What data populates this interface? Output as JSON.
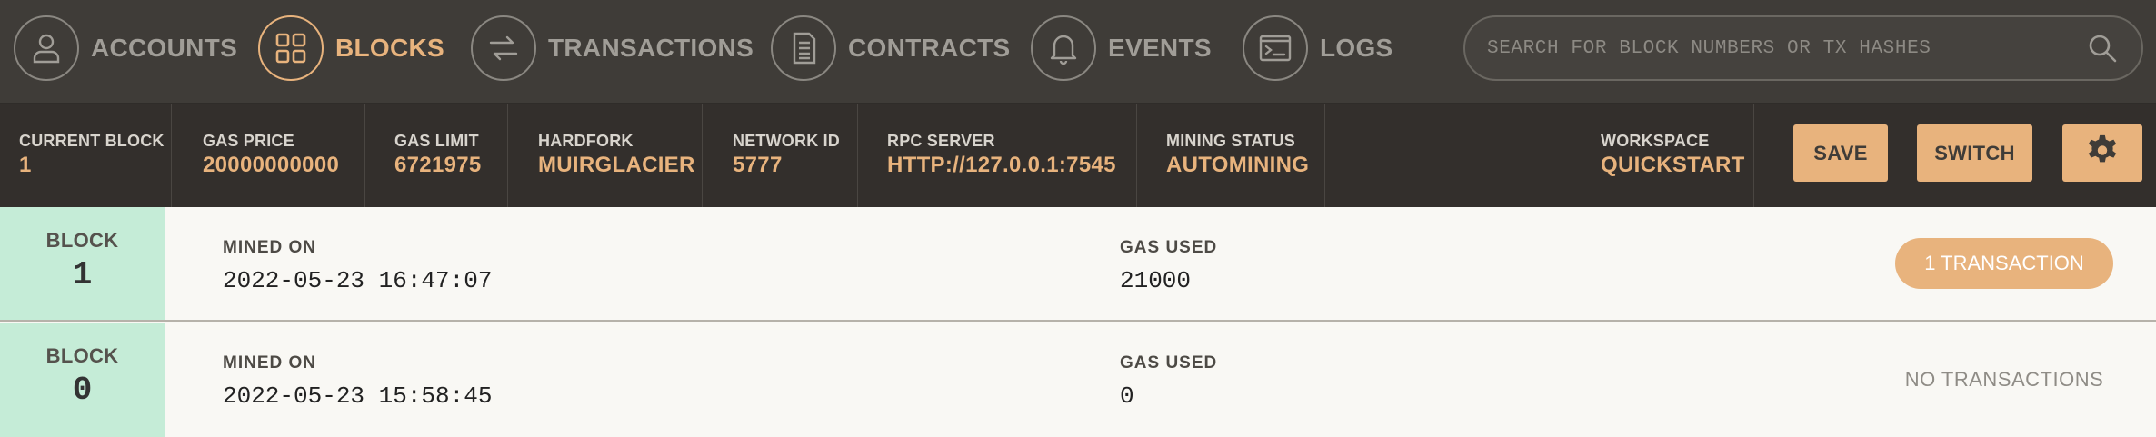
{
  "nav": {
    "items": [
      {
        "label": "ACCOUNTS",
        "icon": "user-icon",
        "active": false
      },
      {
        "label": "BLOCKS",
        "icon": "grid-icon",
        "active": true
      },
      {
        "label": "TRANSACTIONS",
        "icon": "swap-arrows-icon",
        "active": false
      },
      {
        "label": "CONTRACTS",
        "icon": "document-icon",
        "active": false
      },
      {
        "label": "EVENTS",
        "icon": "bell-icon",
        "active": false
      },
      {
        "label": "LOGS",
        "icon": "terminal-icon",
        "active": false
      }
    ],
    "search_placeholder": "SEARCH FOR BLOCK NUMBERS OR TX HASHES"
  },
  "status": {
    "current_block": {
      "label": "CURRENT BLOCK",
      "value": "1"
    },
    "gas_price": {
      "label": "GAS PRICE",
      "value": "20000000000"
    },
    "gas_limit": {
      "label": "GAS LIMIT",
      "value": "6721975"
    },
    "hardfork": {
      "label": "HARDFORK",
      "value": "MUIRGLACIER"
    },
    "network_id": {
      "label": "NETWORK ID",
      "value": "5777"
    },
    "rpc_server": {
      "label": "RPC SERVER",
      "value": "HTTP://127.0.0.1:7545"
    },
    "mining_status": {
      "label": "MINING STATUS",
      "value": "AUTOMINING"
    },
    "workspace": {
      "label": "WORKSPACE",
      "value": "QUICKSTART"
    },
    "save_label": "SAVE",
    "switch_label": "SWITCH",
    "settings_icon": "gear-icon"
  },
  "blocks": [
    {
      "block_label": "BLOCK",
      "number": "1",
      "mined_label": "MINED ON",
      "mined_on": "2022-05-23 16:47:07",
      "gas_label": "GAS USED",
      "gas_used": "21000",
      "tx": "1 TRANSACTION"
    },
    {
      "block_label": "BLOCK",
      "number": "0",
      "mined_label": "MINED ON",
      "mined_on": "2022-05-23 15:58:45",
      "gas_label": "GAS USED",
      "gas_used": "0",
      "tx": "NO TRANSACTIONS"
    }
  ],
  "colors": {
    "accent": "#e8b37d",
    "nav_bg": "#3f3c38",
    "status_bg": "#332f2c",
    "block_bg": "#c5ecd7"
  }
}
